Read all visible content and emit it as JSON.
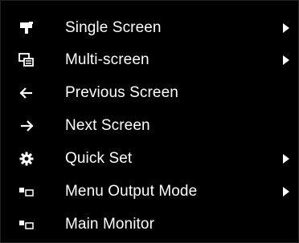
{
  "menu": {
    "items": [
      {
        "label": "Single Screen",
        "icon": "monitor-stand-icon",
        "submenu": true
      },
      {
        "label": "Multi-screen",
        "icon": "multi-screen-icon",
        "submenu": true
      },
      {
        "label": "Previous Screen",
        "icon": "arrow-left-icon",
        "submenu": false
      },
      {
        "label": "Next Screen",
        "icon": "arrow-right-icon",
        "submenu": false
      },
      {
        "label": "Quick Set",
        "icon": "gear-icon",
        "submenu": true
      },
      {
        "label": "Menu Output Mode",
        "icon": "output-mode-icon",
        "submenu": true
      },
      {
        "label": "Main Monitor",
        "icon": "output-mode-icon",
        "submenu": false
      }
    ]
  },
  "colors": {
    "background": "#000000",
    "text": "#ffffff"
  }
}
